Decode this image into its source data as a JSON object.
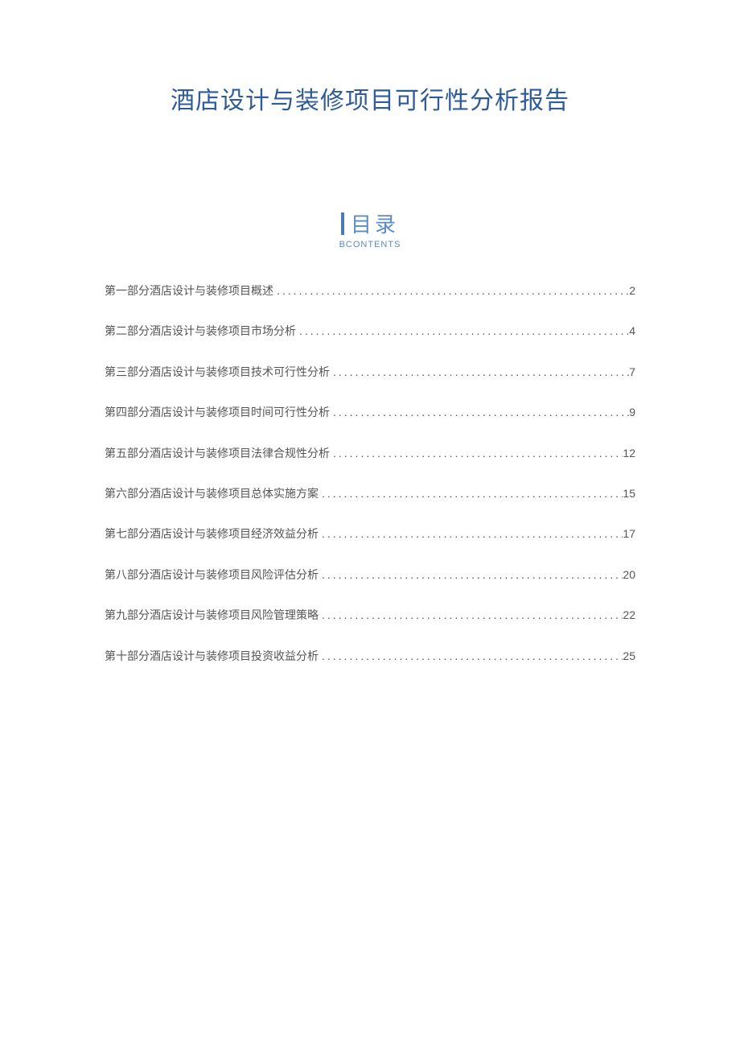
{
  "title": "酒店设计与装修项目可行性分析报告",
  "toc": {
    "label": "目录",
    "sublabel": "BCONTENTS",
    "items": [
      {
        "text": "第一部分酒店设计与装修项目概述",
        "page": "2"
      },
      {
        "text": "第二部分酒店设计与装修项目市场分析",
        "page": "4"
      },
      {
        "text": "第三部分酒店设计与装修项目技术可行性分析",
        "page": "7"
      },
      {
        "text": "第四部分酒店设计与装修项目时间可行性分析",
        "page": "9"
      },
      {
        "text": "第五部分酒店设计与装修项目法律合规性分析",
        "page": "12"
      },
      {
        "text": "第六部分酒店设计与装修项目总体实施方案",
        "page": "15"
      },
      {
        "text": "第七部分酒店设计与装修项目经济效益分析",
        "page": "17"
      },
      {
        "text": "第八部分酒店设计与装修项目风险评估分析",
        "page": "20"
      },
      {
        "text": "第九部分酒店设计与装修项目风险管理策略",
        "page": "22"
      },
      {
        "text": "第十部分酒店设计与装修项目投资收益分析",
        "page": "25"
      }
    ]
  }
}
